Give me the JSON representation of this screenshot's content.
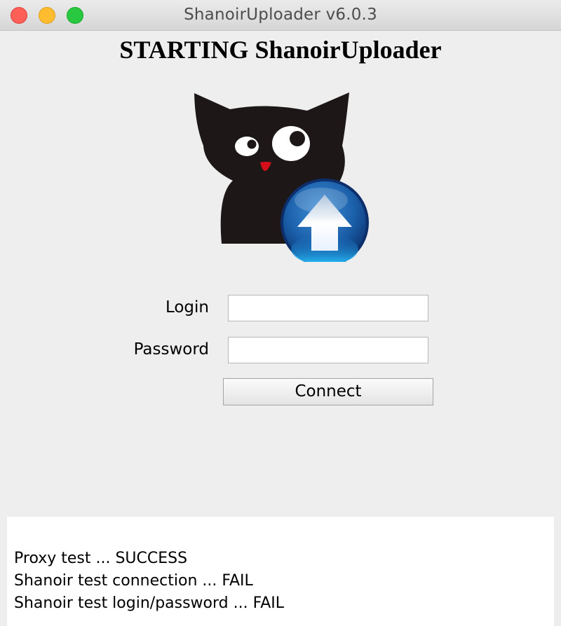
{
  "window": {
    "title": "ShanoirUploader v6.0.3"
  },
  "heading": "STARTING ShanoirUploader",
  "logo": {
    "icon": "cat-upload-logo-icon",
    "colors": {
      "cat": "#1e1718",
      "nose": "#d40f1a",
      "arrow_circle": "#1a5ea8"
    }
  },
  "form": {
    "login_label": "Login",
    "login_value": "",
    "password_label": "Password",
    "password_value": "",
    "connect_label": "Connect"
  },
  "log": {
    "lines": [
      "Proxy test ... SUCCESS",
      "Shanoir test connection ... FAIL",
      "Shanoir test login/password ... FAIL"
    ]
  }
}
